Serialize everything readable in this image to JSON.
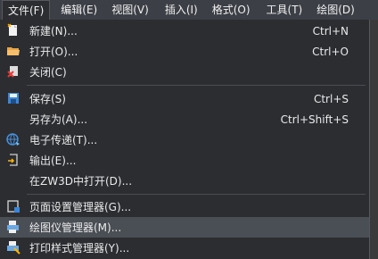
{
  "menubar": {
    "items": [
      {
        "label": "文件(F)"
      },
      {
        "label": "编辑(E)"
      },
      {
        "label": "视图(V)"
      },
      {
        "label": "插入(I)"
      },
      {
        "label": "格式(O)"
      },
      {
        "label": "工具(T)"
      },
      {
        "label": "绘图(D)"
      }
    ]
  },
  "file_menu": {
    "items": [
      {
        "label": "新建(N)...",
        "shortcut": "Ctrl+N",
        "icon": "new-file-icon"
      },
      {
        "label": "打开(O)...",
        "shortcut": "Ctrl+O",
        "icon": "open-folder-icon"
      },
      {
        "label": "关闭(C)",
        "shortcut": "",
        "icon": "close-file-icon"
      },
      {
        "label": "保存(S)",
        "shortcut": "Ctrl+S",
        "icon": "save-icon"
      },
      {
        "label": "另存为(A)...",
        "shortcut": "Ctrl+Shift+S",
        "icon": ""
      },
      {
        "label": "电子传递(T)...",
        "shortcut": "",
        "icon": "etransmit-icon"
      },
      {
        "label": "输出(E)...",
        "shortcut": "",
        "icon": "export-icon"
      },
      {
        "label": "在ZW3D中打开(D)...",
        "shortcut": "",
        "icon": ""
      },
      {
        "label": "页面设置管理器(G)...",
        "shortcut": "",
        "icon": "page-setup-icon"
      },
      {
        "label": "绘图仪管理器(M)...",
        "shortcut": "",
        "icon": "plotter-icon"
      },
      {
        "label": "打印样式管理器(Y)...",
        "shortcut": "",
        "icon": "plot-style-icon"
      }
    ]
  },
  "colors": {
    "menu_bg": "#2b2d31",
    "menubar_bg": "#3c3f45",
    "hover_bg": "#4a4e55",
    "text": "#eaeaea"
  }
}
